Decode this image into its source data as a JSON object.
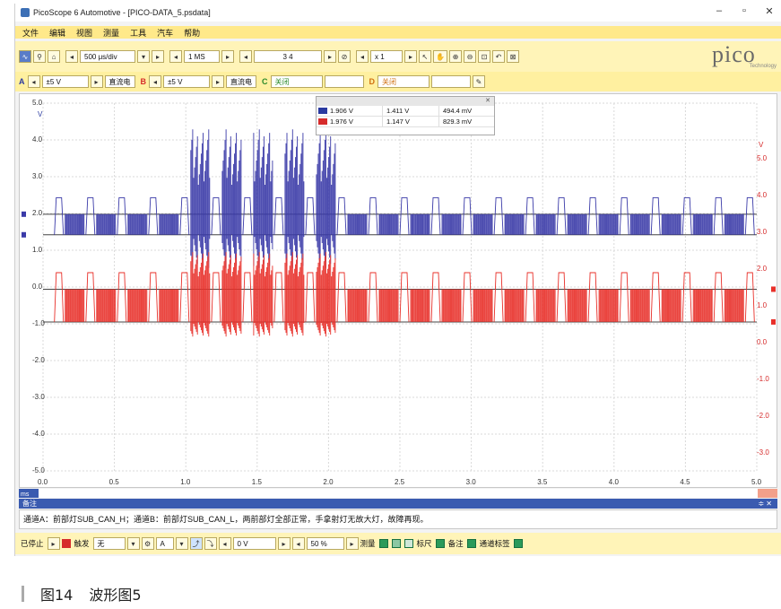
{
  "window": {
    "title": "PicoScope 6 Automotive - [PICO-DATA_5.psdata]",
    "controls": {
      "minimize": "–",
      "restore": "▫",
      "close": "✕"
    }
  },
  "menu": [
    "文件",
    "编辑",
    "视图",
    "测量",
    "工具",
    "汽车",
    "帮助"
  ],
  "toolbar1": {
    "timebase": "500 μs/div",
    "samples": "1 MS",
    "capture_count": "3 4",
    "zoom": "x 1"
  },
  "toolbar2": {
    "channel_a": {
      "letter": "A",
      "range": "±5 V",
      "coupling": "直流电"
    },
    "channel_b": {
      "letter": "B",
      "range": "±5 V",
      "coupling": "直流电"
    },
    "channel_c": {
      "letter": "C",
      "range": "",
      "coupling": "关闭"
    },
    "channel_d": {
      "letter": "D",
      "range": "",
      "coupling": "关闭"
    }
  },
  "logo": {
    "word": "pico",
    "sub": "Technology"
  },
  "scope": {
    "unit_left": "V",
    "unit_right": "V",
    "y_left_labels": [
      "5.0",
      "4.0",
      "3.0",
      "2.0",
      "1.0",
      "0.0",
      "-1.0",
      "-2.0",
      "-3.0",
      "-4.0",
      "-5.0"
    ],
    "y_right_labels": [
      "5.0",
      "4.0",
      "3.0",
      "2.0",
      "1.0",
      "0.0",
      "-1.0",
      "-2.0",
      "-3.0"
    ],
    "x_labels": [
      "0.0",
      "0.5",
      "1.0",
      "1.5",
      "2.0",
      "2.5",
      "3.0",
      "3.5",
      "4.0",
      "4.5",
      "5.0"
    ],
    "x_unit": "ms",
    "colors": {
      "channel_a": "#3a3aa8",
      "channel_b": "#e8302a",
      "grid": "#d9d9d9"
    }
  },
  "measurements": {
    "rows": [
      {
        "v1": "1.906 V",
        "v2": "1.411 V",
        "v3": "494.4 mV"
      },
      {
        "v1": "1.976 V",
        "v2": "1.147 V",
        "v3": "829.3 mV"
      }
    ]
  },
  "notes": {
    "header": "备注",
    "header_controls": "≑ ✕",
    "text": "通道A：前部灯SUB_CAN_H；通道B：前部灯SUB_CAN_L，两前部灯全部正常，手拿射灯无故大灯，故障再现。"
  },
  "bottombar": {
    "stop_label": "已停止",
    "trigger_label": "触发",
    "trigger_mode": "无",
    "channel": "A",
    "level": "0 V",
    "percent": "50 %",
    "measure_label": "测量",
    "ruler_label": "标尺",
    "notes_label": "备注",
    "channel_label": "通道标签"
  },
  "caption": {
    "figure": "图14",
    "title": "波形图5"
  }
}
